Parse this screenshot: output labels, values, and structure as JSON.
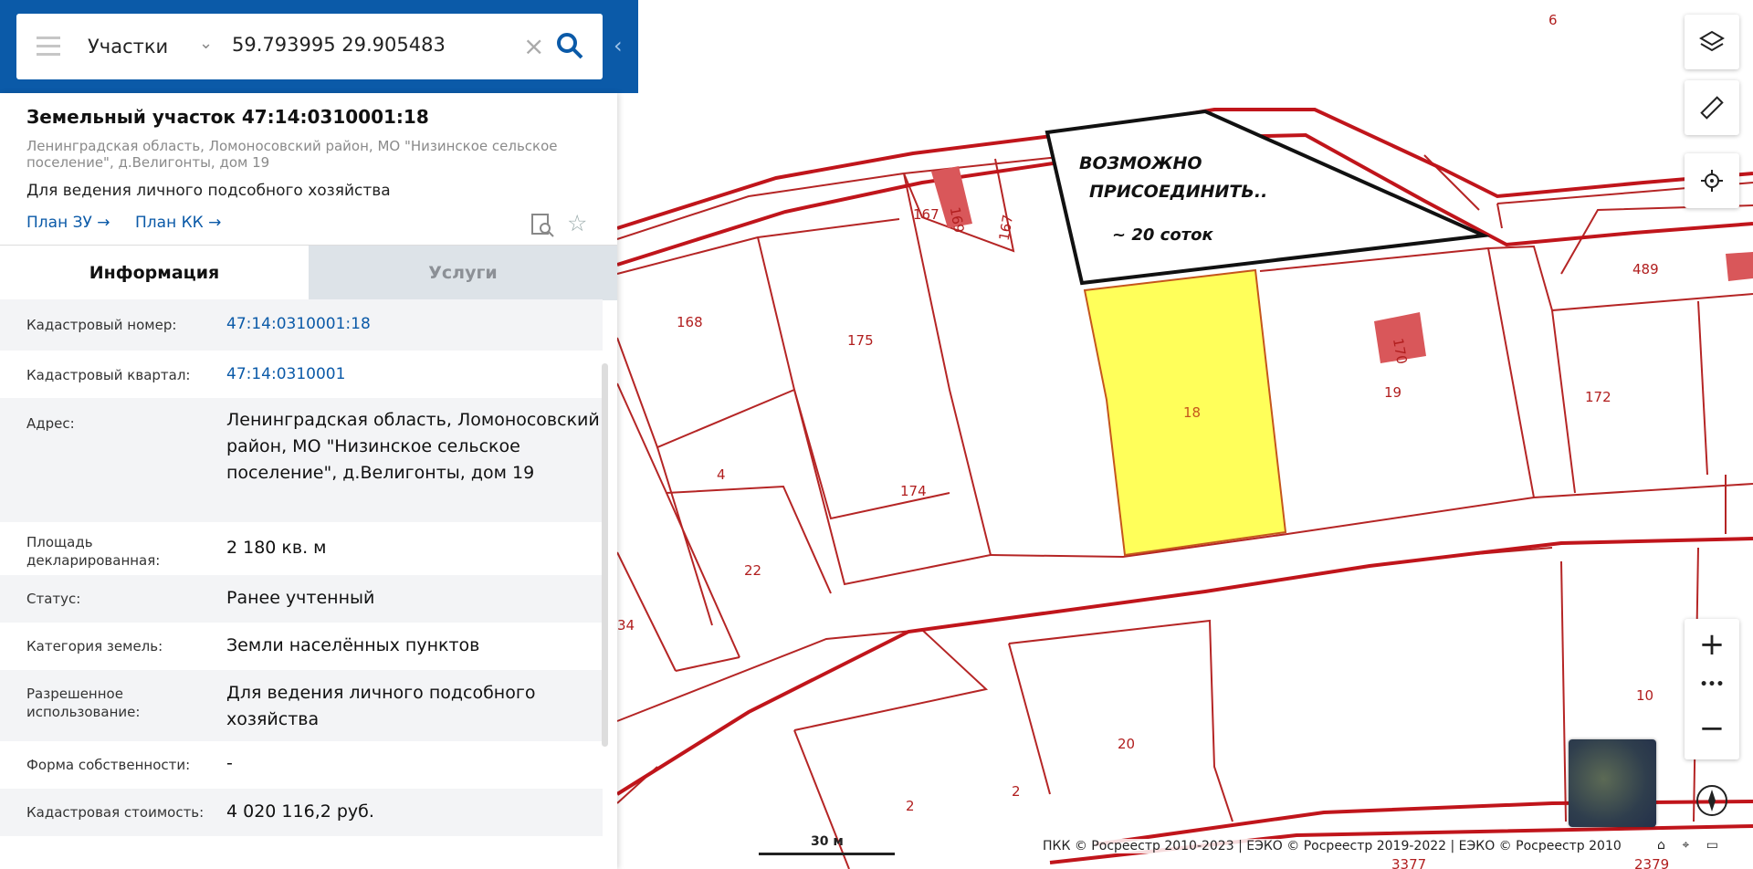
{
  "search": {
    "type_label": "Участки",
    "query": "59.793995 29.905483",
    "icons": {
      "menu": "hamburger-icon",
      "clear": "close-icon",
      "search": "search-icon",
      "collapse": "chevron-left-icon"
    }
  },
  "parcel": {
    "title": "Земельный участок 47:14:0310001:18",
    "address_short": "Ленинградская область, Ломоносовский район, МО \"Низинское сельское поселение\", д.Велигонты, дом 19",
    "purpose": "Для ведения личного подсобного хозяйства",
    "plan_zu": "План ЗУ →",
    "plan_kk": "План КК →"
  },
  "tabs": {
    "info": "Информация",
    "services": "Услуги"
  },
  "info_rows": [
    {
      "label": "Кадастровый номер:",
      "value": "47:14:0310001:18"
    },
    {
      "label": "Кадастровый квартал:",
      "value": "47:14:0310001"
    },
    {
      "label": "Адрес:",
      "value": "Ленинградская область, Ломоносовский район, МО \"Низинское сельское поселение\", д.Велигонты, дом 19"
    },
    {
      "label": "Площадь декларированная:",
      "value": "2 180 кв. м"
    },
    {
      "label": "Статус:",
      "value": "Ранее учтенный"
    },
    {
      "label": "Категория земель:",
      "value": "Земли населённых пунктов"
    },
    {
      "label": "Разрешенное использование:",
      "value": "Для ведения личного подсобного хозяйства"
    },
    {
      "label": "Форма собственности:",
      "value": "-"
    },
    {
      "label": "Кадастровая стоимость:",
      "value": "4 020 116,2 руб."
    }
  ],
  "map": {
    "annotation_line1": "ВОЗМОЖНО",
    "annotation_line2": "ПРИСОЕДИНИТЬ..",
    "annotation_line3": "~ 20 соток",
    "parcel_labels": [
      "6",
      "167",
      "169",
      "167",
      "489",
      "168",
      "175",
      "18",
      "170",
      "19",
      "172",
      "4",
      "174",
      "22",
      "34",
      "20",
      "10",
      "2",
      "2",
      "3377",
      "2379"
    ],
    "scale": "30 м",
    "copyright": "ПКК © Росреестр 2010-2023 | ЕЭКО © Росреестр 2019-2022 | ЕЭКО © Росреестр 2010",
    "colors": {
      "boundary": "#c0151b",
      "parcel_line": "#b52525",
      "selected": "#ffff5a",
      "building": "#d9575a"
    }
  },
  "controls": {
    "zoom_in": "+",
    "more": "•••",
    "zoom_out": "−"
  }
}
